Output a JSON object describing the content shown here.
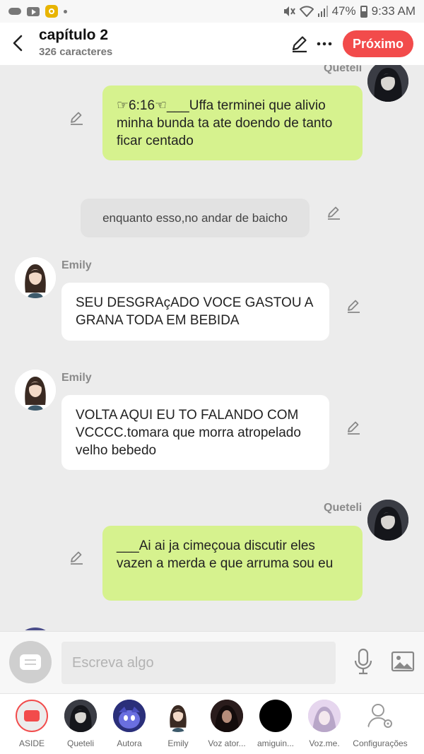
{
  "status_bar": {
    "battery": "47%",
    "time": "9:33 AM"
  },
  "header": {
    "title": "capítulo 2",
    "subtitle": "326 caracteres",
    "next_label": "Próximo"
  },
  "messages": [
    {
      "type": "me",
      "name": "Queteli",
      "text": "☞6:16☜___Uffa terminei que alivio minha bunda ta ate doendo de tanto ficar centado"
    },
    {
      "type": "narration",
      "text": "enquanto esso,no andar de baicho"
    },
    {
      "type": "other",
      "name": "Emily",
      "text": "SEU DESGRAçADO VOCE GASTOU A GRANA TODA EM BEBIDA"
    },
    {
      "type": "other",
      "name": "Emily",
      "text": "VOLTA AQUI EU TO FALANDO COM VCCCC.tomara que morra atropelado velho bebedo"
    },
    {
      "type": "me",
      "name": "Queteli",
      "text": "___Ai ai ja cimeçoua discutir eles vazen a merda e que arruma sou eu"
    }
  ],
  "input": {
    "placeholder": "Escreva algo"
  },
  "characters": [
    {
      "label": "ASIDE",
      "icon": "aside-icon"
    },
    {
      "label": "Queteli"
    },
    {
      "label": "Autora"
    },
    {
      "label": "Emily"
    },
    {
      "label": "Voz ator..."
    },
    {
      "label": "amiguin..."
    },
    {
      "label": "Voz.me."
    },
    {
      "label": "Configurações",
      "icon": "settings-person-icon"
    }
  ],
  "colors": {
    "accent": "#f24b4b",
    "my_bubble": "#d6f28e",
    "other_bubble": "#ffffff",
    "chat_background": "#ececec"
  }
}
